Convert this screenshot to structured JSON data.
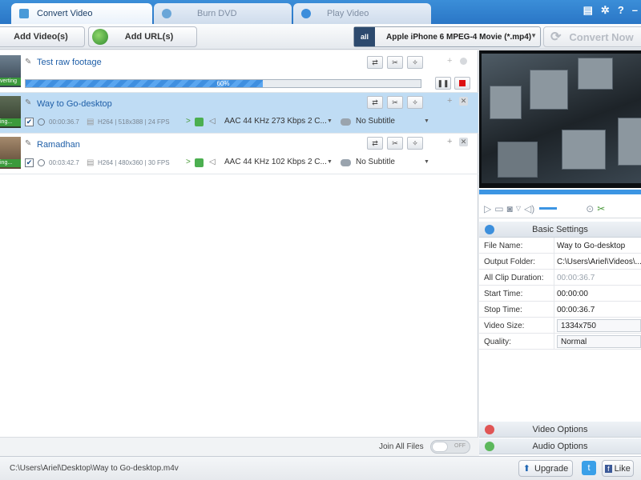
{
  "tabs": [
    {
      "label": "Convert Video",
      "active": true
    },
    {
      "label": "Burn DVD",
      "active": false
    },
    {
      "label": "Play Video",
      "active": false
    }
  ],
  "window_controls": {
    "help": "?"
  },
  "toolbar": {
    "add_videos": "Add Video(s)",
    "add_urls": "Add URL(s)",
    "profile_icon_text": "all",
    "profile": "Apple iPhone 6 MPEG-4 Movie (*.mp4)",
    "convert_now": "Convert Now"
  },
  "files": [
    {
      "name": "Test raw footage",
      "badge": "verting",
      "progress_text": "60%",
      "progress": 0.6
    },
    {
      "name": "Way to Go-desktop",
      "badge": "ing...",
      "duration": "00:00:36.7",
      "video_info": "H264 | 518x388 | 24 FPS",
      "audio": "AAC 44 KHz 273 Kbps 2 C...",
      "subtitle": "No Subtitle"
    },
    {
      "name": "Ramadhan",
      "badge": "ing...",
      "duration": "00:03:42.7",
      "video_info": "H264 | 480x360 | 30 FPS",
      "audio": "AAC 44 KHz 102 Kbps 2 C...",
      "subtitle": "No Subtitle"
    }
  ],
  "join": {
    "label": "Join All Files",
    "toggle": "OFF"
  },
  "status": {
    "path": "C:\\Users\\Ariel\\Desktop\\Way to Go-desktop.m4v",
    "upgrade": "Upgrade",
    "like": "Like"
  },
  "panel": {
    "basic_settings": "Basic Settings",
    "rows": [
      {
        "label": "File Name:",
        "value": "Way to Go-desktop"
      },
      {
        "label": "Output Folder:",
        "value": "C:\\Users\\Ariel\\Videos\\..."
      },
      {
        "label": "All Clip Duration:",
        "value": "00:00:36.7"
      },
      {
        "label": "Start Time:",
        "value": "00:00:00"
      },
      {
        "label": "Stop Time:",
        "value": "00:00:36.7"
      },
      {
        "label": "Video Size:",
        "value": "1334x750"
      },
      {
        "label": "Quality:",
        "value": "Normal"
      }
    ],
    "video_options": "Video Options",
    "audio_options": "Audio Options"
  },
  "colors": {
    "accent": "#2a76c6",
    "selected_row": "#bfdcf4",
    "progress": "#3f8fe0"
  }
}
